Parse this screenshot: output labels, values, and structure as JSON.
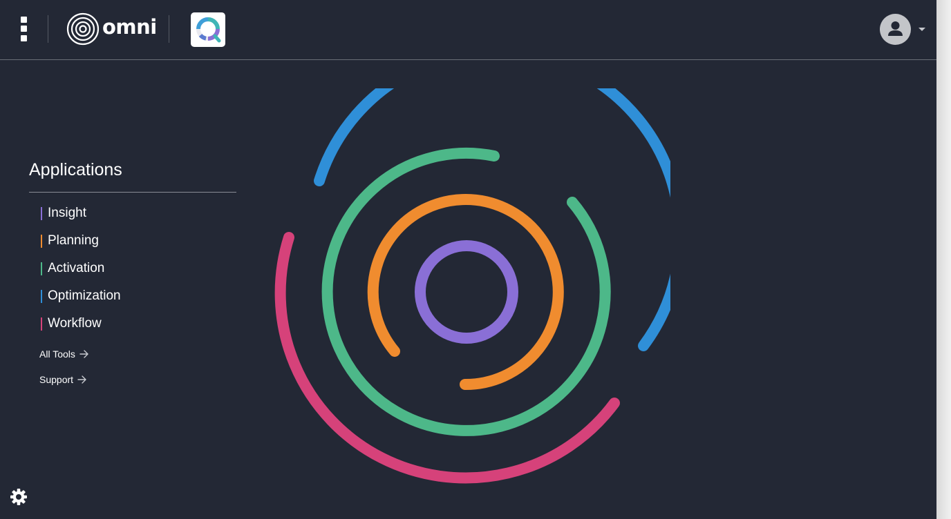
{
  "header": {
    "menu_icon": "more-vertical-icon",
    "brand_name": "omni",
    "app_icon": "insight-app-icon",
    "avatar_icon": "user-avatar-icon",
    "caret_icon": "caret-down-icon"
  },
  "applications": {
    "title": "Applications",
    "items": [
      {
        "label": "Insight",
        "color": "#8a6fd6"
      },
      {
        "label": "Planning",
        "color": "#f08c2f"
      },
      {
        "label": "Activation",
        "color": "#4db889"
      },
      {
        "label": "Optimization",
        "color": "#2f8fd8"
      },
      {
        "label": "Workflow",
        "color": "#d6427a"
      }
    ]
  },
  "links": {
    "all_tools": "All Tools",
    "support": "Support",
    "arrow_icon": "arrow-right-icon"
  },
  "footer": {
    "settings_icon": "gear-icon"
  },
  "graphic": {
    "name": "concentric-arcs-logo",
    "colors": [
      "#8a6fd6",
      "#f08c2f",
      "#4db889",
      "#2f8fd8",
      "#d6427a"
    ]
  }
}
